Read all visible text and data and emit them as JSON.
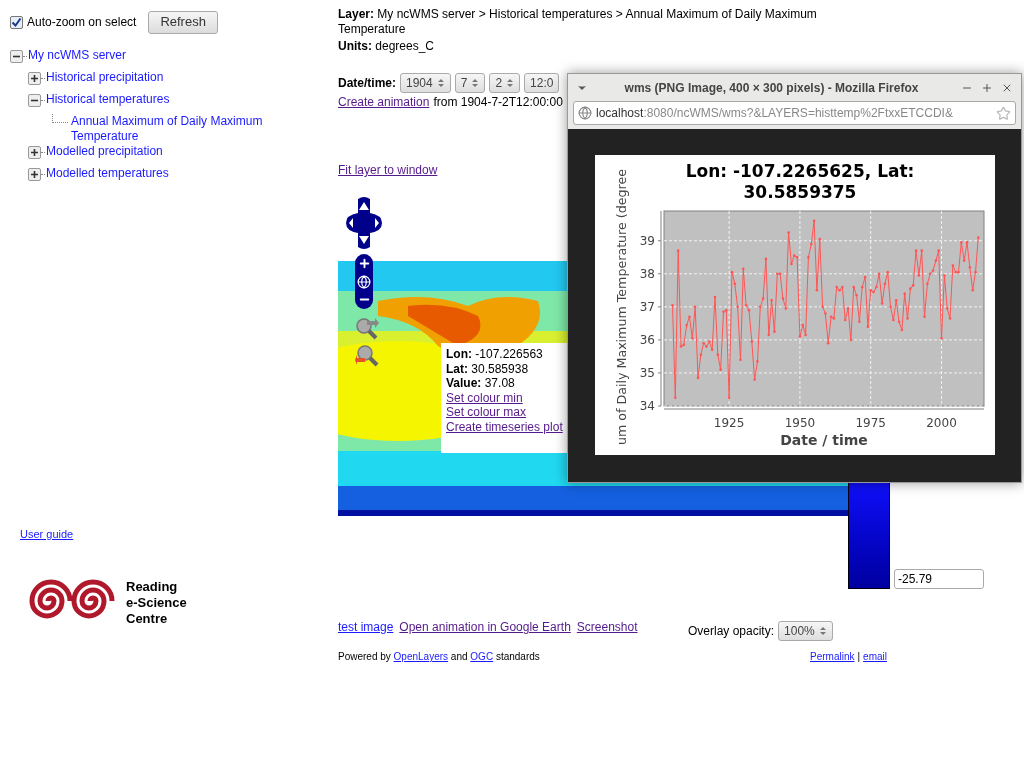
{
  "sidebar": {
    "auto_zoom": {
      "label": "Auto-zoom on select",
      "checked": true
    },
    "refresh_button": "Refresh",
    "tree": [
      {
        "label": "My ncWMS server",
        "expanded": true,
        "children": [
          {
            "label": "Historical precipitation",
            "expanded": false
          },
          {
            "label": "Historical temperatures",
            "expanded": true,
            "children": [
              {
                "label": "Annual Maximum of Daily Maximum Temperature"
              }
            ]
          },
          {
            "label": "Modelled precipitation",
            "expanded": false
          },
          {
            "label": "Modelled temperatures",
            "expanded": false
          }
        ]
      }
    ],
    "user_guide": "User guide",
    "logo_text": [
      "Reading",
      "e-Science",
      "Centre"
    ]
  },
  "layer": "**Layer:** My ncWMS server > Historical temperatures > Annual Maximum of Daily Maximum Temperature",
  "units": "**Units:** degrees_C",
  "date_time": {
    "label": "Date/time:",
    "fields": [
      "1904",
      "7",
      "2",
      "12:0"
    ]
  },
  "animation": {
    "link": "Create animation",
    "text": "from 1904-7-2T12:00:00"
  },
  "fit_layer": "Fit layer to window",
  "map_popup": {
    "lines": [
      "**Lon:** -107.226563",
      "**Lat:** 30.585938",
      "**Value:** 37.08"
    ],
    "links": [
      "Set colour min",
      "Set colour max",
      "Create timeseries plot"
    ]
  },
  "colour_scale": {
    "min_value": "-25.79"
  },
  "footer_links": [
    {
      "label": "test image",
      "visited": false
    },
    {
      "label": "Open animation in Google Earth",
      "visited": true
    },
    {
      "label": "Screenshot",
      "visited": true
    }
  ],
  "overlay_opacity": {
    "label": "Overlay opacity:",
    "value": "100%"
  },
  "powered_by": {
    "prefix": "Powered by",
    "link_1": "OpenLayers",
    "middle": "and",
    "link_2": "OGC",
    "suffix": "standards"
  },
  "permalinks": {
    "permalink": "Permalink",
    "separator": "|",
    "email": "email"
  },
  "popup_window": {
    "title": "wms (PNG Image, 400 × 300 pixels) - Mozilla Firefox",
    "url_host": "localhost",
    "url_rest": ":8080/ncWMS/wms?&LAYERS=histtemp%2FtxxETCCDI&",
    "chart_data": {
      "type": "line",
      "title": "Lon: -107.2265625, Lat: 30.5859375",
      "xlabel": "Date / time",
      "ylabel": "um of Daily Maximum Temperature (degree",
      "xlim": [
        1902,
        2015
      ],
      "ylim": [
        34,
        39.9
      ],
      "xticks": [
        1925,
        1950,
        1975,
        2000
      ],
      "yticks": [
        34,
        35,
        36,
        37,
        38,
        39
      ],
      "x": [
        1905,
        1906,
        1907,
        1908,
        1909,
        1910,
        1911,
        1912,
        1913,
        1914,
        1915,
        1916,
        1917,
        1918,
        1919,
        1920,
        1921,
        1922,
        1923,
        1924,
        1925,
        1926,
        1927,
        1928,
        1929,
        1930,
        1931,
        1932,
        1933,
        1934,
        1935,
        1936,
        1937,
        1938,
        1939,
        1940,
        1941,
        1942,
        1943,
        1944,
        1945,
        1946,
        1947,
        1948,
        1949,
        1950,
        1951,
        1952,
        1953,
        1954,
        1955,
        1956,
        1957,
        1958,
        1959,
        1960,
        1961,
        1962,
        1963,
        1964,
        1965,
        1966,
        1967,
        1968,
        1969,
        1970,
        1971,
        1972,
        1973,
        1974,
        1975,
        1976,
        1977,
        1978,
        1979,
        1980,
        1981,
        1982,
        1983,
        1984,
        1985,
        1986,
        1987,
        1988,
        1989,
        1990,
        1991,
        1992,
        1993,
        1994,
        1995,
        1996,
        1997,
        1998,
        1999,
        2000,
        2001,
        2002,
        2003,
        2004,
        2005,
        2006,
        2007,
        2008,
        2009,
        2010,
        2011,
        2012,
        2013
      ],
      "grid": true,
      "series": [
        {
          "color": "#ff5555",
          "values": [
            37.05,
            34.25,
            38.7,
            35.8,
            35.85,
            36.45,
            36.7,
            36.05,
            37.0,
            34.85,
            35.55,
            35.9,
            35.8,
            35.95,
            35.7,
            37.3,
            35.55,
            35.1,
            36.85,
            36.9,
            34.25,
            38.05,
            37.7,
            37.0,
            35.4,
            38.15,
            37.05,
            36.9,
            35.95,
            34.8,
            35.35,
            37.0,
            37.25,
            38.45,
            36.15,
            37.2,
            36.25,
            38.0,
            38.0,
            37.25,
            36.95,
            39.25,
            38.3,
            38.55,
            38.5,
            36.1,
            36.45,
            36.15,
            38.5,
            38.9,
            39.6,
            37.5,
            39.05,
            37.0,
            36.8,
            35.9,
            36.7,
            36.65,
            37.6,
            37.5,
            37.6,
            36.6,
            36.95,
            36.0,
            37.6,
            37.35,
            36.55,
            37.6,
            37.9,
            36.4,
            37.5,
            37.45,
            37.6,
            38.0,
            37.1,
            37.7,
            38.05,
            37.0,
            36.6,
            37.2,
            36.55,
            36.3,
            37.4,
            36.65,
            37.55,
            37.65,
            38.7,
            37.95,
            38.7,
            36.7,
            37.7,
            38.0,
            38.1,
            38.4,
            38.7,
            36.05,
            37.95,
            36.95,
            36.65,
            38.25,
            38.05,
            38.05,
            38.95,
            38.4,
            38.95,
            38.2,
            37.5,
            38.05,
            39.1
          ]
        }
      ]
    }
  }
}
